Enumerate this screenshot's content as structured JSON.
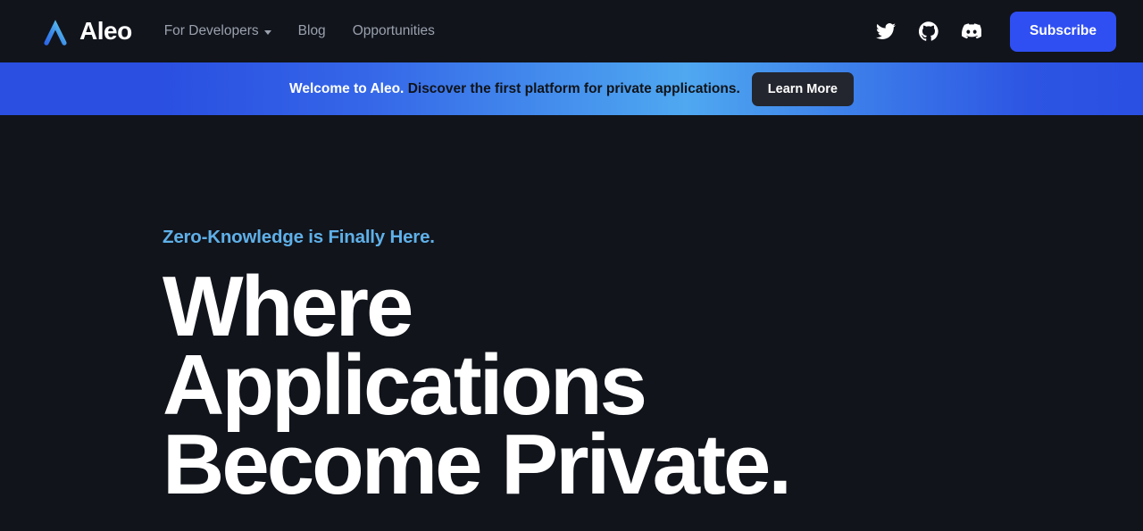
{
  "colors": {
    "page_background": "#11141b",
    "accent_blue": "#2f4ff2",
    "eyebrow_blue": "#5fb0e8",
    "nav_link_gray": "#9aa1ad",
    "logo_gradient_start": "#2a5fe8",
    "logo_gradient_end": "#6fe0f0",
    "banner_gradient_edge": "#2a4fe1",
    "banner_gradient_center": "#4fa8f0",
    "learn_more_button": "#23262e"
  },
  "navbar": {
    "brand": {
      "name": "Aleo",
      "logo_icon": "aleo-chevron-logo"
    },
    "links": [
      {
        "label": "For Developers",
        "has_dropdown": true,
        "dropdown_icon": "chevron-down-icon"
      },
      {
        "label": "Blog",
        "has_dropdown": false
      },
      {
        "label": "Opportunities",
        "has_dropdown": false
      }
    ],
    "social": [
      {
        "name": "twitter-icon",
        "label": "Twitter"
      },
      {
        "name": "github-icon",
        "label": "GitHub"
      },
      {
        "name": "discord-icon",
        "label": "Discord"
      }
    ],
    "subscribe_label": "Subscribe"
  },
  "banner": {
    "lead_text": "Welcome to Aleo.",
    "rest_text": "Discover the first platform for private applications.",
    "button_label": "Learn More"
  },
  "hero": {
    "eyebrow": "Zero-Knowledge is Finally Here.",
    "headline_lines": [
      "Where",
      "Applications",
      "Become Private."
    ]
  }
}
